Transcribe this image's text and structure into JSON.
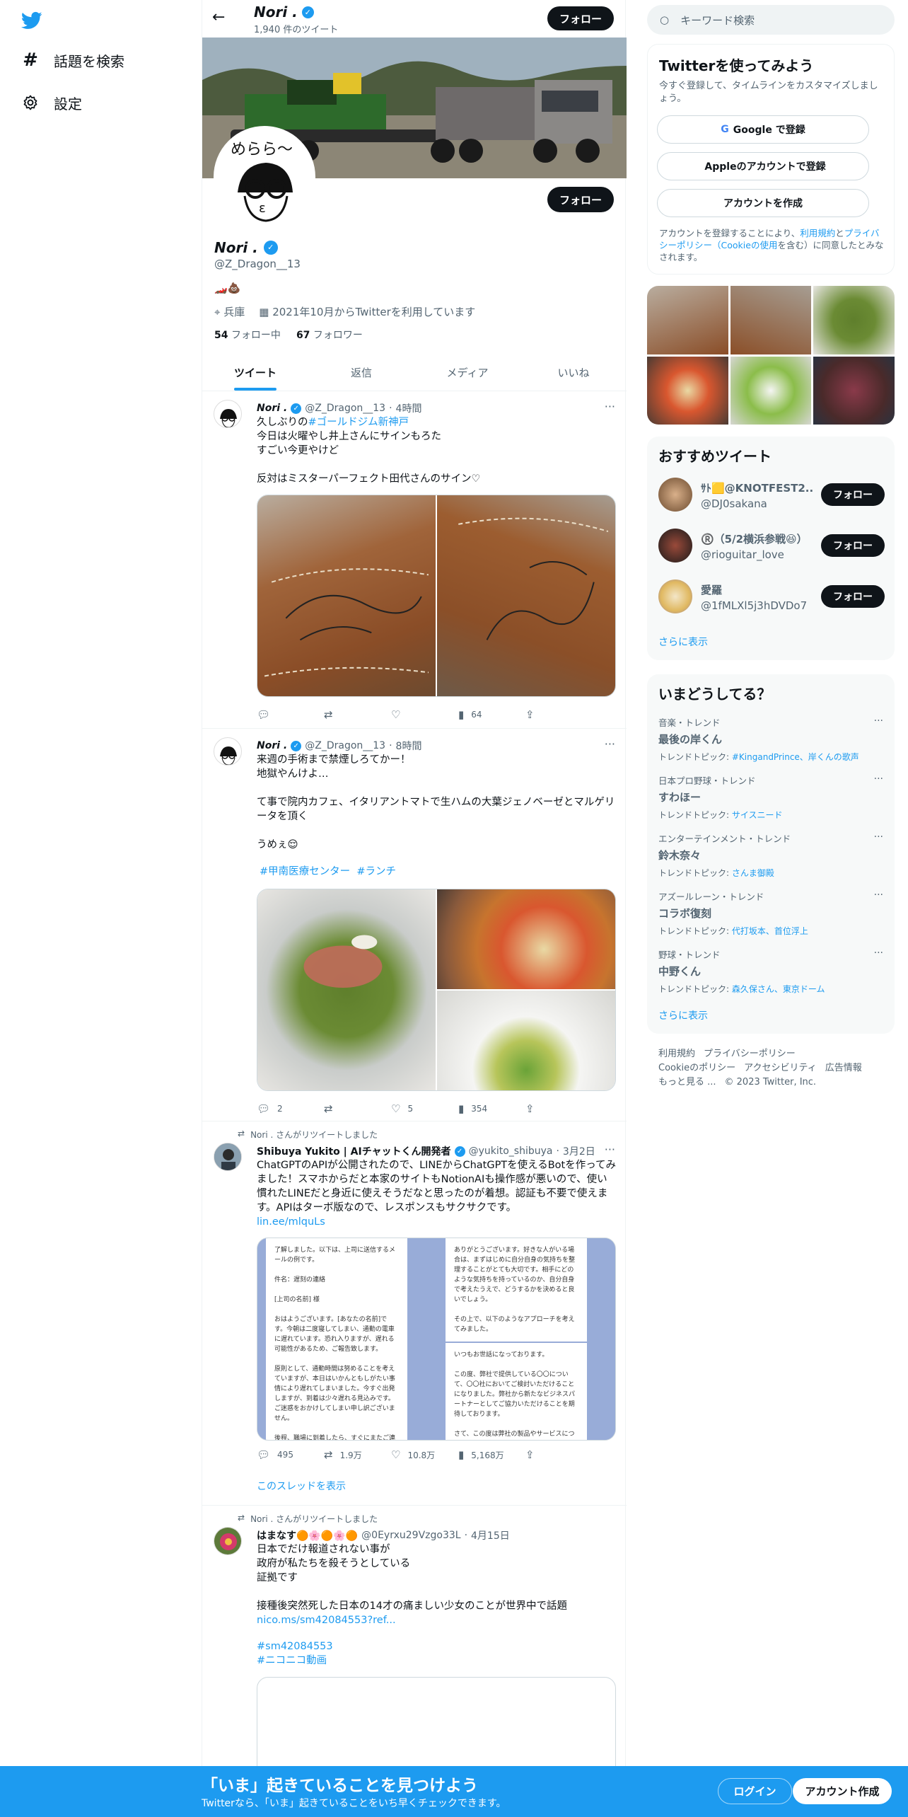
{
  "nav": {
    "explore": "話題を検索",
    "settings": "設定"
  },
  "profile": {
    "name": "Nori .",
    "tweet_count": "1,940 件のツイート",
    "follow": "フォロー",
    "handle": "@Z_Dragon__13",
    "bio": "🏎️💩",
    "location": "兵庫",
    "joined": "2021年10月からTwitterを利用しています",
    "following_count": "54",
    "following_label": "フォロー中",
    "followers_count": "67",
    "followers_label": "フォロワー"
  },
  "tabs": [
    "ツイート",
    "返信",
    "メディア",
    "いいね"
  ],
  "tweets": [
    {
      "name": "Nori .",
      "handle": "@Z_Dragon__13",
      "time": "4時間",
      "text_pre": "久しぶりの",
      "hashtag": "#ゴールドジム新神戸",
      "text": "今日は火曜やし井上さんにサインもろた\nすごい今更やけど\n\n反対はミスターパーフェクト田代さんのサイン♡",
      "reply": "",
      "retweet": "",
      "like": "",
      "views": "64"
    },
    {
      "name": "Nori .",
      "handle": "@Z_Dragon__13",
      "time": "8時間",
      "text": "来週の手術まで禁煙しろてかー！\n地獄やんけよ…\n\nて事で院内カフェ、イタリアントマトで生ハムの大葉ジェノベーゼとマルゲリータを頂く\n\nうめぇ😌",
      "tags": "#甲南医療センター  #ランチ",
      "reply": "2",
      "retweet": "",
      "like": "5",
      "views": "354"
    },
    {
      "rt_label": "Nori . さんがリツイートしました",
      "name": "Shibuya Yukito | AIチャットくん開発者",
      "handle": "@yukito_shibuya",
      "time": "3月2日",
      "text": "ChatGPTのAPIが公開されたので、LINEからChatGPTを使えるBotを作ってみました！スマホからだと本家のサイトもNotionAIも操作感が悪いので、使い慣れたLINEだと身近に使えそうだなと思ったのが着想。認証も不要で使えます。APIはターボ版なので、レスポンスもサクサクです。",
      "link": "lin.ee/mlquLs",
      "doc1": "了解しました。以下は、上司に送信するメールの例です。\n\n件名：遅刻の連絡\n\n[上司の名前] 様\n\nおはようございます。[あなたの名前]です。今朝は二度寝してしまい、通勤の電車に遅れています。恐れ入りますが、遅れる可能性があるため、ご報告致します。\n\n原則として、通勤時間は努めることを考えていますが、本日はいかんともしがたい事情により遅れてしまいました。今すぐ出発しますが、到着は少々遅れる見込みです。ご迷惑をおかけしてしまい申し訳ございません。\n\n後程、職場に到着したら、すぐにまたご連絡差し上げます。ご対応",
      "doc2": "ありがとうございます。好きな人がいる場合は、まずはじめに自分自身の気持ちを整理することがとても大切です。相手にどのような気持ちを持っているのか、自分自身で考えたうえで、どうするかを決めると良いでしょう。\n\nその上で、以下のようなアプローチを考えてみました。",
      "doc3": "いつもお世話になっております。\n\nこの度、弊社で提供している〇〇について、〇〇社においてご検討いただけることになりました。弊社から新たなビジネスパートナーとしてご協力いただけることを期待しております。\n\nさて、この度は弊社の製品やサービスについてお話しさせていただ",
      "reply": "495",
      "retweet": "1.9万",
      "like": "10.8万",
      "views": "5,168万",
      "thread": "このスレッドを表示"
    },
    {
      "rt_label": "Nori . さんがリツイートしました",
      "name": "はまなす🟠🌸🟠🌸🟠",
      "handle": "@0Eyrxu29Vzgo33L",
      "time": "4月15日",
      "text": "日本でだけ報道されない事が\n政府が私たちを殺そうとしている\n証拠です\n\n接種後突然死した日本の14才の痛ましい少女のことが世界中で話題",
      "link": "nico.ms/sm42084553?ref...",
      "tag1": "#sm42084553",
      "tag2": "#ニコニコ動画"
    }
  ],
  "right": {
    "search_placeholder": "キーワード検索",
    "join_title": "Twitterを使ってみよう",
    "join_sub": "今すぐ登録して、タイムラインをカスタマイズしましょう。",
    "google_btn": "Google で登録",
    "apple_btn": "Appleのアカウントで登録",
    "create_btn": "アカウントを作成",
    "terms_pre": "アカウントを登録することにより、",
    "terms_link1": "利用規約",
    "terms_mid": "と",
    "terms_link2": "プライバシーポリシー",
    "terms_link3": "（Cookieの使用",
    "terms_post": "を含む）に同意したとみなされます。",
    "rec_title": "おすすめツイート",
    "rec": [
      {
        "name": "ｻﾄ🟨@KNOTFEST2...",
        "handle": "@DJ0sakana",
        "btn": "フォロー"
      },
      {
        "name": "®️（5/2横浜参戦😆）",
        "handle": "@rioguitar_love",
        "btn": "フォロー"
      },
      {
        "name": "愛羅",
        "handle": "@1fMLXl5j3hDVDo7",
        "btn": "フォロー"
      }
    ],
    "show_more": "さらに表示",
    "trend_title": "いまどうしてる？",
    "trends": [
      {
        "cat": "音楽・トレンド",
        "title": "最後の岸くん",
        "topic_label": "トレンドトピック:",
        "topics": "#KingandPrince、岸くんの歌声"
      },
      {
        "cat": "日本プロ野球・トレンド",
        "title": "すわほー",
        "topic_label": "トレンドトピック:",
        "topics": "サイスニード"
      },
      {
        "cat": "エンターテインメント・トレンド",
        "title": "鈴木奈々",
        "topic_label": "トレンドトピック:",
        "topics": "さんま御殿"
      },
      {
        "cat": "アズールレーン・トレンド",
        "title": "コラボ復刻",
        "topic_label": "トレンドトピック:",
        "topics": "代打坂本、首位浮上"
      },
      {
        "cat": "野球・トレンド",
        "title": "中野くん",
        "topic_label": "トレンドトピック:",
        "topics": "森久保さん、東京ドーム"
      }
    ],
    "show_more2": "さらに表示",
    "footer": [
      "利用規約",
      "プライバシーポリシー",
      "Cookieのポリシー",
      "アクセシビリティ",
      "広告情報",
      "もっと見る ...",
      "© 2023 Twitter, Inc."
    ]
  },
  "bottom": {
    "title": "「いま」起きていることを見つけよう",
    "sub": "Twitterなら、「いま」起きていることをいち早くチェックできます。",
    "login": "ログイン",
    "signup": "アカウント作成"
  },
  "colors": {
    "accent": "#1d9bf0",
    "text": "#0f1419",
    "muted": "#536471"
  }
}
